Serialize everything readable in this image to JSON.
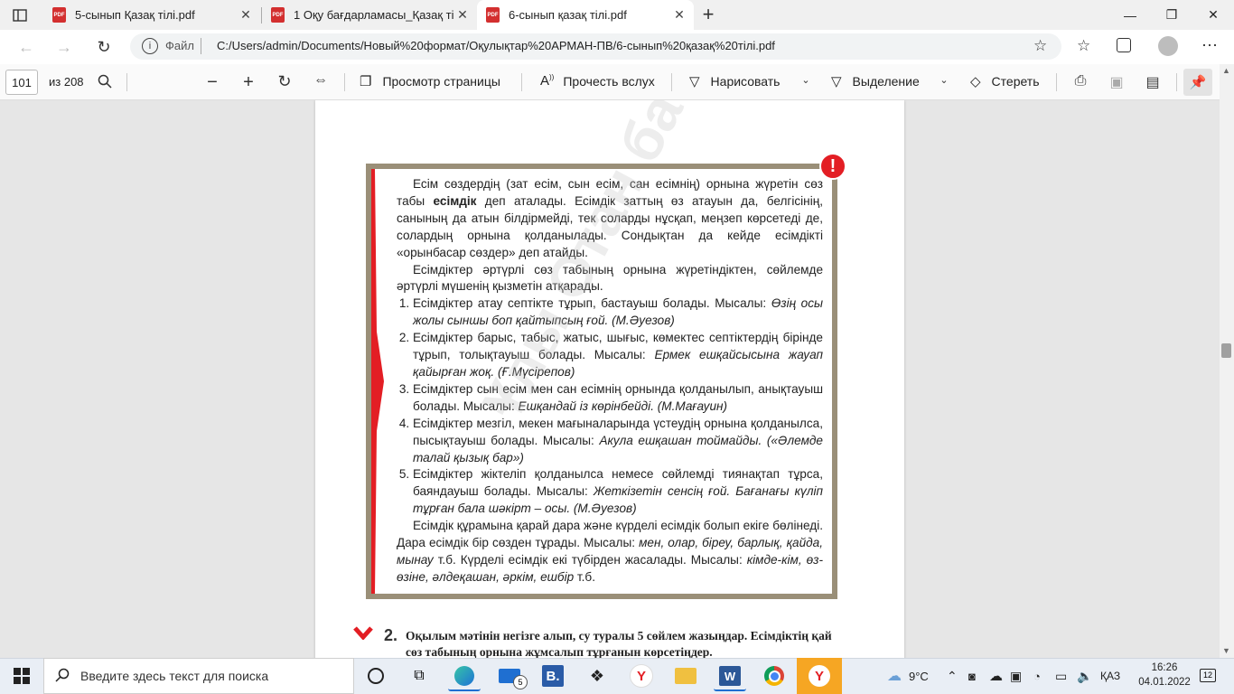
{
  "tabs": [
    {
      "title": "5-сынып Қазақ тілі.pdf",
      "active": false
    },
    {
      "title": "1 Оқу бағдарламасы_Қазақ тілі",
      "active": false
    },
    {
      "title": "6-сынып қазақ тілі.pdf",
      "active": true
    }
  ],
  "address": {
    "file_label": "Файл",
    "url": "C:/Users/admin/Documents/Новый%20формат/Оқулықтар%20АРМАН-ПВ/6-сынып%20қазақ%20тілі.pdf"
  },
  "pdf_toolbar": {
    "page_number": "101",
    "page_total": "из 208",
    "page_view": "Просмотр страницы",
    "read_aloud": "Прочесть вслух",
    "draw": "Нарисовать",
    "highlight": "Выделение",
    "erase": "Стереть"
  },
  "content": {
    "intro1_a": "Есім сөздердің (зат есім, сын есім, сан есімнің) орнына жүретін сөз табы ",
    "intro1_bold": "есімдік",
    "intro1_b": " деп аталады. Есімдік заттың өз атауын да, белгісінің, санының да атын білдірмейді, тек соларды нұсқап, меңзеп көрсетеді де, солардың орнына қолданылады. Сондықтан да кейде есімдікті «орынбасар сөздер» деп атайды.",
    "intro2": "Есімдіктер әртүрлі сөз табының орнына жүретіндіктен, сөйлемде әртүрлі мүшенің қызметін атқарады.",
    "items": [
      {
        "text": "Есімдіктер атау септікте тұрып, бастауыш болады. Мысалы: ",
        "example": "Өзің осы жолы сыншы боп қайтыпсың ғой. (М.Әуезов)"
      },
      {
        "text": "Есімдіктер барыс, табыс, жатыс, шығыс, көмектес септіктердің бірінде тұрып, толықтауыш болады. Мысалы: ",
        "example": "Ермек ешқайсысына жауап қайырған жоқ. (Ғ.Мүсірепов)"
      },
      {
        "text": "Есімдіктер сын есім мен сан есімнің орнында қолданылып, анықтауыш болады. Мысалы: ",
        "example": "Ешқандай із көрінбейді. (М.Мағауин)"
      },
      {
        "text": "Есімдіктер мезгіл, мекен мағыналарында үстеудің орнына қолданылса, пысықтауыш болады. Мысалы: ",
        "example": "Акула ешқашан тоймайды. («Әлемде талай қызық бар»)"
      },
      {
        "text": "Есімдіктер жіктеліп қолданылса немесе сөйлемді тиянақтап тұрса, баяндауыш болады. Мысалы: ",
        "example": "Жеткізетін сенсің ғой. Бағанағы күліп тұрған бала шәкірт – осы. (М.Әуезов)"
      }
    ],
    "outro_a": "Есімдік құрамына қарай дара және күрделі есімдік болып екіге бөлінеді. Дара есімдік бір сөзден тұрады. Мысалы: ",
    "outro_ex1": "мен, олар, біреу, барлық, қайда, мынау",
    "outro_b": " т.б. Күрделі есімдік екі түбірден жасалады. Мысалы: ",
    "outro_ex2": "кімде-кім, өз-өзіне, әлдеқашан, әркім, ешбір",
    "outro_c": " т.б.",
    "alert_symbol": "!",
    "task_number": "2.",
    "task_text": "Оқылым мәтінін негізге алып, су туралы 5 сөйлем жазыңдар. Есімдіктің қай сөз табының орнына жұмсалып тұрғанын көрсетіңдер.",
    "watermark": "Ұлы Отан баспасы"
  },
  "taskbar": {
    "search_placeholder": "Введите здесь текст для поиска",
    "mail_badge": "5",
    "weather": "9°C",
    "language": "ҚАЗ",
    "time": "16:26",
    "date": "04.01.2022",
    "notifications": "12"
  },
  "colors": {
    "accent_red": "#e31e24",
    "box_border": "#9a8f78",
    "taskbar": "#e9eef5"
  }
}
